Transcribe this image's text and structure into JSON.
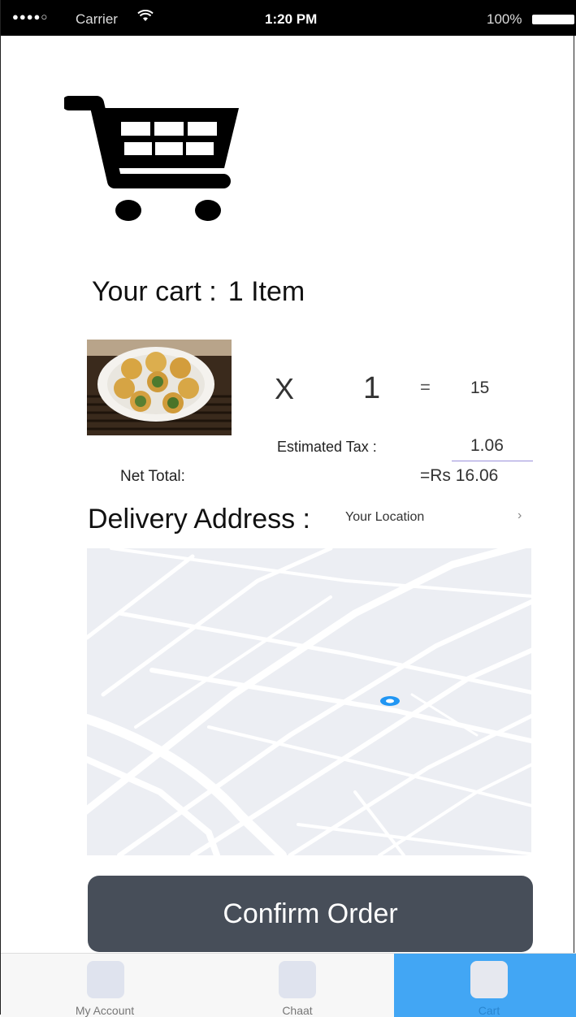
{
  "status_bar": {
    "signal": "●●●●○",
    "carrier": "Carrier",
    "wifi_icon": "wifi-icon",
    "time": "1:20 PM",
    "battery": "100%"
  },
  "cart": {
    "icon": "shopping-cart-icon",
    "title": "Your cart :",
    "count": "1 Item"
  },
  "item": {
    "image": "food-plate-photo",
    "times_symbol": "X",
    "quantity": "1",
    "equals_symbol": "=",
    "price": "15"
  },
  "tax": {
    "label": "Estimated Tax :",
    "value": "1.06"
  },
  "net_total": {
    "label": "Net Total:",
    "value": "=Rs 16.06"
  },
  "delivery": {
    "title": "Delivery Address :",
    "location": "Your Location",
    "chevron": "›"
  },
  "confirm_button": "Confirm Order",
  "tabs": [
    {
      "label": "My Account",
      "icon": "account-icon",
      "active": false
    },
    {
      "label": "Chaat",
      "icon": "chaat-icon",
      "active": false
    },
    {
      "label": "Cart",
      "icon": "cart-tab-icon",
      "active": true
    }
  ],
  "colors": {
    "confirm_bg": "#474e59",
    "active_tab": "#42a6f4",
    "map_bg": "#eceef3",
    "map_marker": "#2196f3"
  }
}
